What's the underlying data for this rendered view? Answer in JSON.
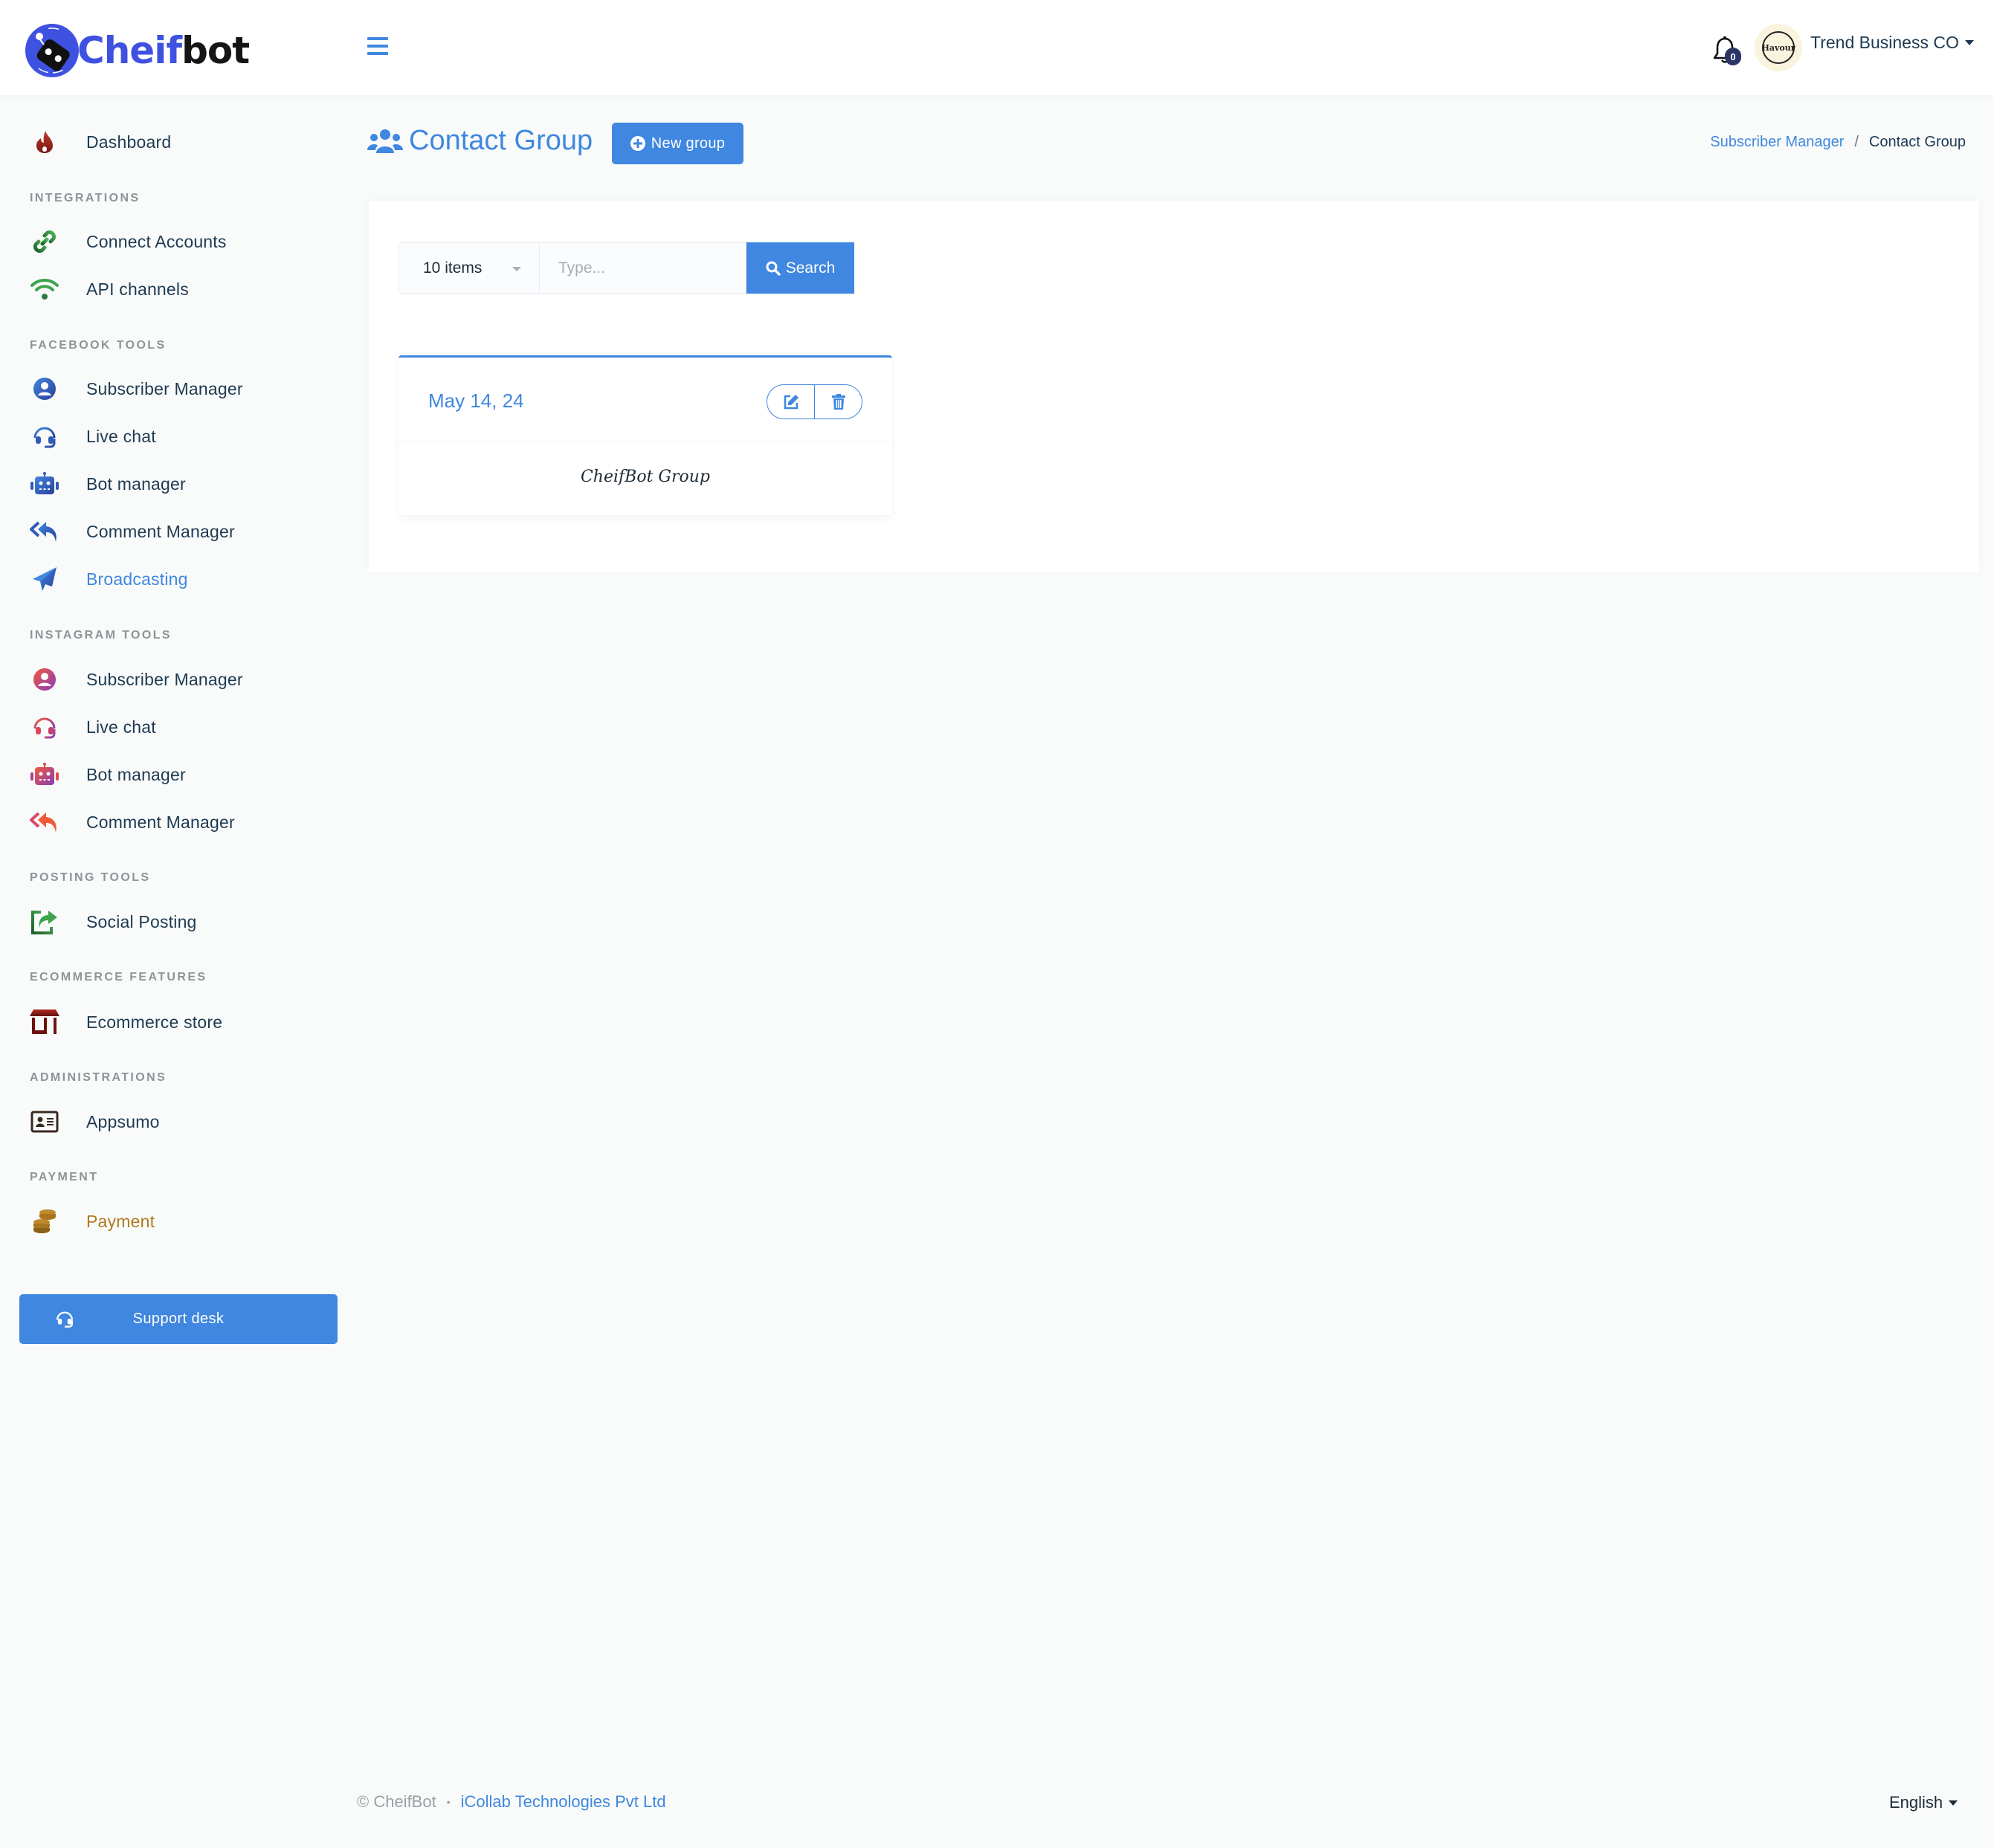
{
  "app": {
    "brand_part1": "Cheif",
    "brand_part2": "bot"
  },
  "header": {
    "notification_count": "0",
    "avatar_text": "Havour",
    "user_name": "Trend Business CO"
  },
  "sidebar": {
    "dashboard": {
      "label": "Dashboard",
      "icon": "fire-icon"
    },
    "sections": [
      {
        "title": "INTEGRATIONS",
        "items": [
          {
            "label": "Connect Accounts",
            "icon": "link-icon"
          },
          {
            "label": "API channels",
            "icon": "wifi-icon"
          }
        ]
      },
      {
        "title": "FACEBOOK TOOLS",
        "items": [
          {
            "label": "Subscriber Manager",
            "icon": "user-circle-icon"
          },
          {
            "label": "Live chat",
            "icon": "headset-icon"
          },
          {
            "label": "Bot manager",
            "icon": "robot-icon"
          },
          {
            "label": "Comment Manager",
            "icon": "reply-all-icon"
          },
          {
            "label": "Broadcasting",
            "icon": "paper-plane-icon",
            "active": true
          }
        ]
      },
      {
        "title": "INSTAGRAM TOOLS",
        "items": [
          {
            "label": "Subscriber Manager",
            "icon": "user-circle-icon"
          },
          {
            "label": "Live chat",
            "icon": "headset-icon"
          },
          {
            "label": "Bot manager",
            "icon": "robot-icon"
          },
          {
            "label": "Comment Manager",
            "icon": "reply-all-icon"
          }
        ]
      },
      {
        "title": "POSTING TOOLS",
        "items": [
          {
            "label": "Social Posting",
            "icon": "share-square-icon"
          }
        ]
      },
      {
        "title": "ECOMMERCE FEATURES",
        "items": [
          {
            "label": "Ecommerce store",
            "icon": "store-icon"
          }
        ]
      },
      {
        "title": "ADMINISTRATIONS",
        "items": [
          {
            "label": "Appsumo",
            "icon": "id-card-icon"
          }
        ]
      },
      {
        "title": "PAYMENT",
        "items": [
          {
            "label": "Payment",
            "icon": "coins-icon"
          }
        ]
      }
    ],
    "support_label": "Support desk"
  },
  "page": {
    "title": "Contact Group",
    "new_group_label": "New group",
    "breadcrumb": {
      "parent": "Subscriber Manager",
      "separator": "/",
      "current": "Contact Group"
    }
  },
  "filters": {
    "page_size_selected": "10 items",
    "search_placeholder": "Type...",
    "search_value": "",
    "search_button_label": "Search"
  },
  "groups": [
    {
      "date": "May 14, 24",
      "name": "CheifBot Group"
    }
  ],
  "footer": {
    "copyright": "© CheifBot",
    "bullet": "•",
    "company": "iCollab Technologies Pvt Ltd",
    "language": "English"
  },
  "colors": {
    "accent": "#3f87e0",
    "brand_blue": "#3f51e0",
    "text_dark": "#1e3a52",
    "section_gray": "#8d9498",
    "payment_gold": "#b07a1e"
  }
}
